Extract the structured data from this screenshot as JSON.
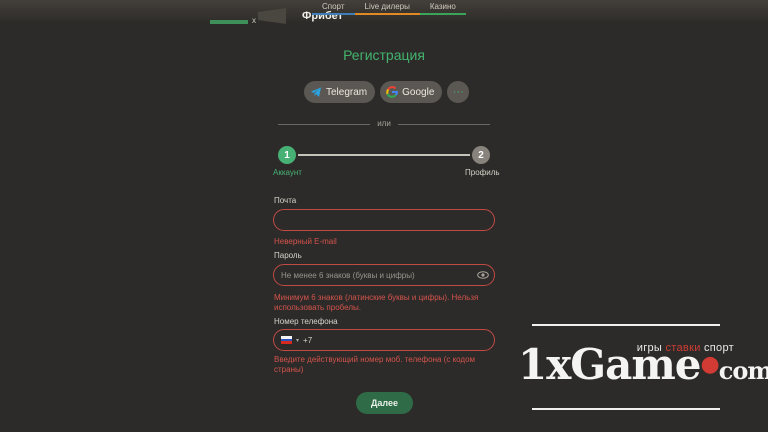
{
  "header": {
    "brand": "Фрибет",
    "nav": [
      "Спорт",
      "Live дилеры",
      "Казино"
    ]
  },
  "form": {
    "title": "Регистрация",
    "social": {
      "telegram": "Telegram",
      "google": "Google",
      "more": "···"
    },
    "or": "или",
    "steps": [
      {
        "number": "1",
        "label": "Аккаунт"
      },
      {
        "number": "2",
        "label": "Профиль"
      }
    ],
    "email": {
      "label": "Почта",
      "value": "",
      "error": "Неверный E-mail"
    },
    "password": {
      "label": "Пароль",
      "placeholder": "Не менее 6 знаков (буквы и цифры)",
      "error_line1": "Минимум 6 знаков (латинские буквы и цифры). Нельзя",
      "error_line2": "использовать пробелы."
    },
    "phone": {
      "label": "Номер телефона",
      "value": "+7",
      "error_line1": "Введите действующий номер моб. телефона (с кодом",
      "error_line2": "страны)"
    },
    "next_label": "Далее"
  },
  "watermark": {
    "tagline_start": "игры",
    "tagline_mid": "ставки",
    "tagline_end": "спорт",
    "logo_main": "1xGame",
    "logo_dot": "●",
    "logo_tld": "com"
  },
  "colors": {
    "accent": "#43b36e",
    "error": "#d4534c",
    "background": "#2c2b29"
  }
}
